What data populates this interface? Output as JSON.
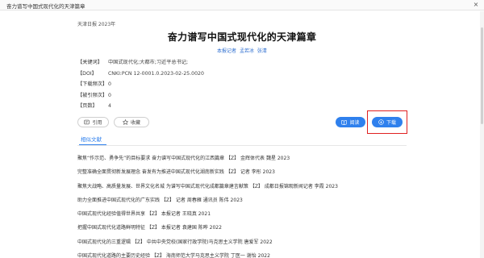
{
  "window": {
    "title": "奋力谱写中国式现代化的天津篇章",
    "close_glyph": "×"
  },
  "article": {
    "source": "天津日报 2023年",
    "title": "奋力谱写中国式现代化的天津篇章",
    "authors": [
      "本报记者",
      "孟若冰",
      "张清"
    ],
    "meta": [
      {
        "label": "【关键词】",
        "value": "中国式现代化;大都市;习近平总书记;"
      },
      {
        "label": "【DOI】",
        "value": "CNKI:PCN 12-0001.0.2023-02-25.0020"
      },
      {
        "label": "【下载频次】",
        "value": "0"
      },
      {
        "label": "【被引频次】",
        "value": "0"
      },
      {
        "label": "【页数】",
        "value": "4"
      }
    ]
  },
  "actions": {
    "cite_label": "引用",
    "favorite_label": "收藏",
    "read_label": "阅读",
    "download_label": "下载"
  },
  "related": {
    "tab_label": "相似文献",
    "items": [
      "聚焦“作示范、勇争先”的目标要求 奋力谱写中国式现代化的江西篇章 【Z】 金辉体代表 魏星 2023",
      "完整准确全面贯彻新发展理念 奋发有为推进中国式现代化湖南新实践 【Z】 记者 李彤 2023",
      "聚焦大战略、高质量发展、世界文化名城 为谱写中国式现代化成都篇章建言献策 【Z】 成都日报锦观新闻记者 李霞 2023",
      "助力全面推进中国式现代化的广东实践 【Z】 记者 周春雁 通讯员 陈伟 2023",
      "中国式现代化经验值得世界共享 【Z】 本报记者 王晓真 2021",
      "把握中国式现代化道路鲜明特征 【Z】 本报记者 袁建国 陈晔 2022",
      "中国式现代化的三重逻辑 【Z】 中共中央党校(国家行政学院)马克思主义学院 唐爱军 2022",
      "中国式现代化道路的主要历史经验 【Z】 海南师范大学马克思主义学院 丁医一 谢怡 2022"
    ]
  },
  "colors": {
    "accent": "#2f80ed",
    "highlight": "#e02020"
  },
  "icons": [
    "close-icon",
    "quote-icon",
    "star-icon",
    "book-icon",
    "download-icon"
  ]
}
